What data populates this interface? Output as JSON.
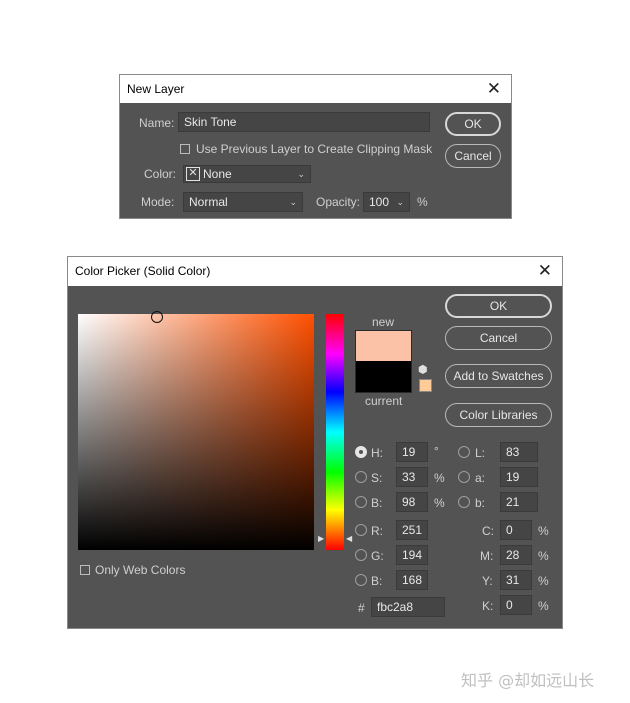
{
  "new_layer": {
    "title": "New Layer",
    "name_label": "Name:",
    "name_value": "Skin Tone",
    "clipping_label": "Use Previous Layer to Create Clipping Mask",
    "color_label": "Color:",
    "color_value": "None",
    "mode_label": "Mode:",
    "mode_value": "Normal",
    "opacity_label": "Opacity:",
    "opacity_value": "100",
    "opacity_unit": "%",
    "ok_label": "OK",
    "cancel_label": "Cancel"
  },
  "color_picker": {
    "title": "Color Picker (Solid Color)",
    "new_label": "new",
    "current_label": "current",
    "new_color": "#fbc2a8",
    "current_color": "#000000",
    "hue_color": "#ff5000",
    "buttons": {
      "ok": "OK",
      "cancel": "Cancel",
      "add_to_swatches": "Add to Swatches",
      "color_libraries": "Color Libraries"
    },
    "only_web_colors": "Only Web Colors",
    "hsb": [
      {
        "label": "H:",
        "value": "19",
        "unit": "°",
        "selected": true
      },
      {
        "label": "S:",
        "value": "33",
        "unit": "%",
        "selected": false
      },
      {
        "label": "B:",
        "value": "98",
        "unit": "%",
        "selected": false
      }
    ],
    "rgb": [
      {
        "label": "R:",
        "value": "251"
      },
      {
        "label": "G:",
        "value": "194"
      },
      {
        "label": "B:",
        "value": "168"
      }
    ],
    "lab": [
      {
        "label": "L:",
        "value": "83"
      },
      {
        "label": "a:",
        "value": "19"
      },
      {
        "label": "b:",
        "value": "21"
      }
    ],
    "cmyk": [
      {
        "label": "C:",
        "value": "0",
        "unit": "%"
      },
      {
        "label": "M:",
        "value": "28",
        "unit": "%"
      },
      {
        "label": "Y:",
        "value": "31",
        "unit": "%"
      },
      {
        "label": "K:",
        "value": "0",
        "unit": "%"
      }
    ],
    "hex_label": "#",
    "hex_value": "fbc2a8"
  },
  "watermark": "知乎 @却如远山长"
}
